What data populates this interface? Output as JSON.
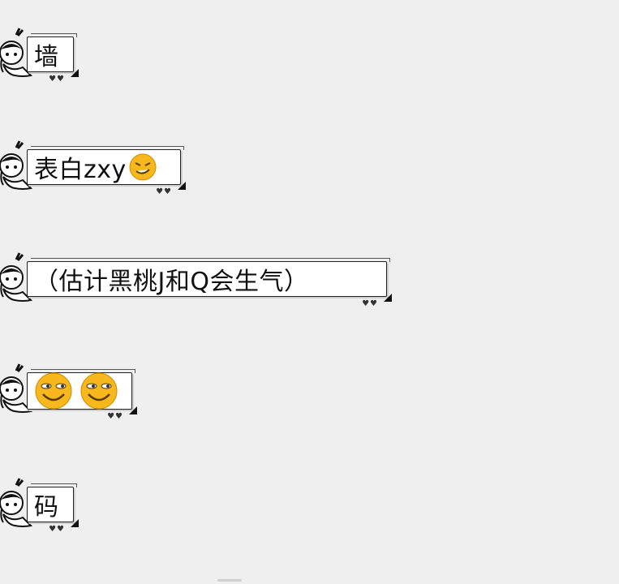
{
  "messages": [
    {
      "text": "墙",
      "icons": []
    },
    {
      "text": "表白zxy",
      "icons": [
        "smirk-emoji-icon"
      ]
    },
    {
      "text": "（估计黑桃J和Q会生气）",
      "icons": []
    },
    {
      "text": "",
      "icons": [
        "sly-smile-emoji-icon",
        "sly-smile-emoji-icon"
      ]
    },
    {
      "text": "码",
      "icons": []
    }
  ],
  "colors": {
    "background": "#efefef",
    "bubble": "#ffffff",
    "border": "#222222",
    "emoji": "#f6b81c"
  }
}
